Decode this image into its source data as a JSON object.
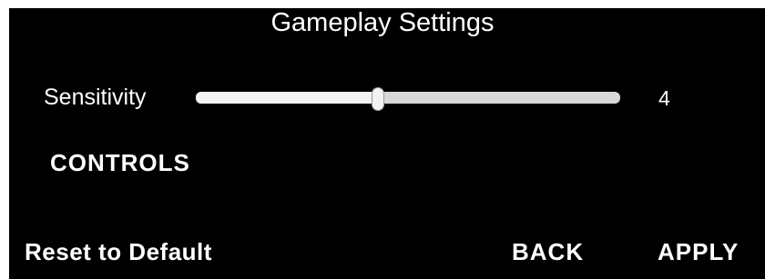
{
  "title": "Gameplay Settings",
  "sensitivity": {
    "label": "Sensitivity",
    "value": "4",
    "fraction": 0.43
  },
  "controls_label": "CONTROLS",
  "footer": {
    "reset_label": "Reset to Default",
    "back_label": "BACK",
    "apply_label": "APPLY"
  },
  "colors": {
    "background": "#000000",
    "text": "#ffffff",
    "track": "#d8d8d8",
    "track_fill": "#f4f4f4"
  }
}
